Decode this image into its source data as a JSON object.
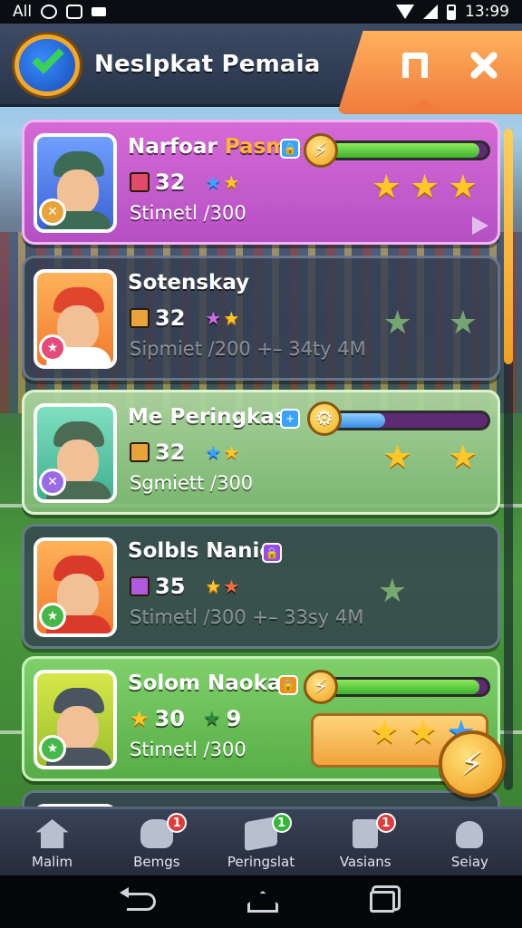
{
  "status_bar": {
    "carrier": "All",
    "time": "13:99"
  },
  "header": {
    "title": "Neslpkat Pemaia",
    "back_icon": "back-icon",
    "close_icon": "close-icon"
  },
  "players": [
    {
      "name": "Narfoar",
      "name_accent": "Pasme",
      "level": "32",
      "subtitle": "Stimetl /300",
      "progress": 0.95,
      "stars": 3,
      "card_color": "#c95fcf"
    },
    {
      "name": "Sotenskay",
      "level": "32",
      "subtitle": "Sipmiet /200 +– 34ty 4M",
      "stars": 2,
      "card_color": "#343e52"
    },
    {
      "name": "Me Peringkas",
      "level": "32",
      "subtitle": "Sgmiett /300",
      "progress": 0.4,
      "stars": 2,
      "card_color": "#a6d396"
    },
    {
      "name": "Solbls Nanie",
      "level": "35",
      "subtitle": "Stimetl /300 +– 33sy 4M",
      "stars": 1,
      "card_color": "#343e52"
    },
    {
      "name": "Solom Naoka",
      "level": "30",
      "secondary_value": "9",
      "subtitle": "Stimetl /300",
      "progress": 0.95,
      "stars": 3,
      "card_color": "#70c35c"
    }
  ],
  "bottom_nav": [
    {
      "label": "Malim",
      "icon": "home-icon"
    },
    {
      "label": "Bemgs",
      "icon": "controller-icon",
      "badge": "1",
      "badge_color": "#e23b3b"
    },
    {
      "label": "Peringslat",
      "icon": "box-icon",
      "badge": "1",
      "badge_color": "#35b83a"
    },
    {
      "label": "Vasians",
      "icon": "device-icon",
      "badge": "1",
      "badge_color": "#e23b3b"
    },
    {
      "label": "Seiay",
      "icon": "user-icon"
    }
  ]
}
